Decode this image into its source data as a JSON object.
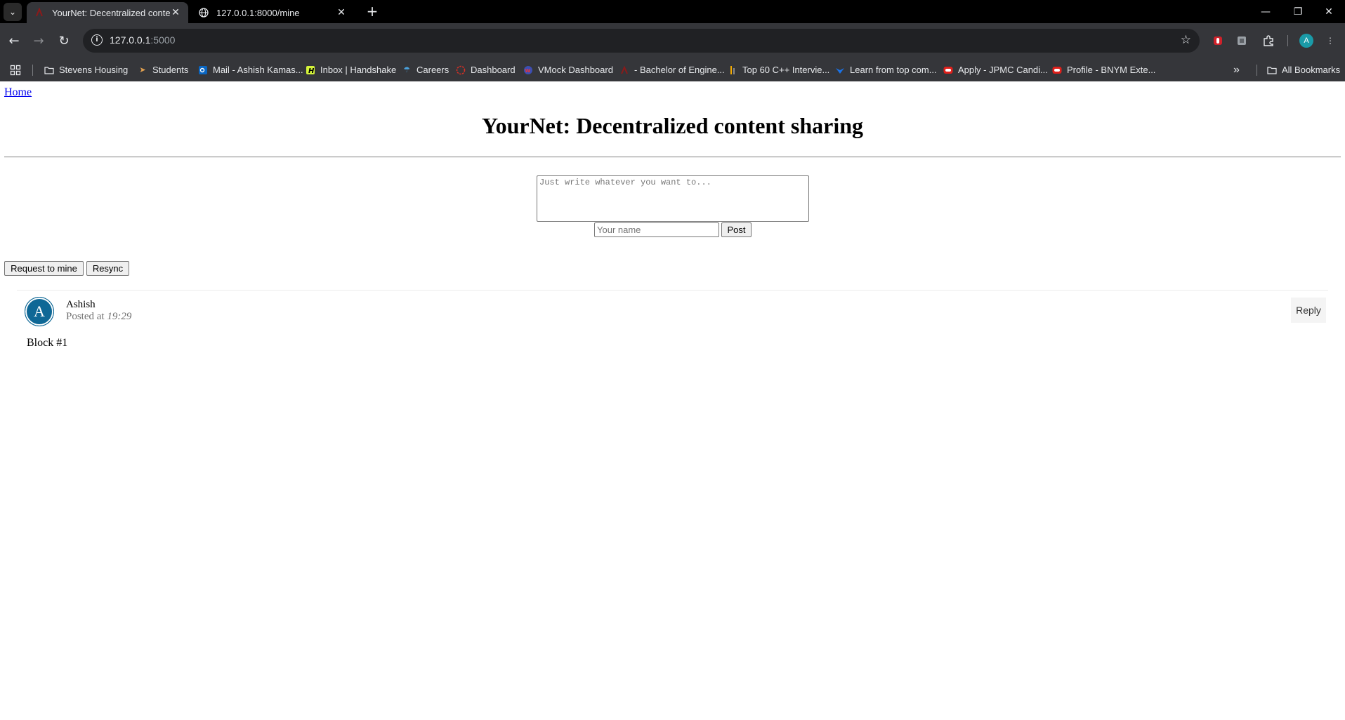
{
  "browser": {
    "tabs": [
      {
        "title": "YourNet: Decentralized content sharing",
        "active": true
      },
      {
        "title": "127.0.0.1:8000/mine",
        "active": false
      }
    ],
    "new_tab_label": "+",
    "url_host": "127.0.0.1",
    "url_rest": ":5000",
    "profile_initial": "A",
    "bookmarks": [
      "Stevens Housing",
      "Students",
      "Mail - Ashish Kamas...",
      "Inbox | Handshake",
      "Careers",
      "Dashboard",
      "VMock Dashboard",
      "- Bachelor of Engine...",
      "Top 60 C++ Intervie...",
      "Learn from top com...",
      "Apply - JPMC Candi...",
      "Profile - BNYM Exte..."
    ],
    "bookmarks_overflow": "»",
    "all_bookmarks": "All Bookmarks"
  },
  "page": {
    "home_link": "Home",
    "title": "YourNet: Decentralized content sharing",
    "content_placeholder": "Just write whatever you want to...",
    "name_placeholder": "Your name",
    "post_button": "Post",
    "request_mine_button": "Request to mine",
    "resync_button": "Resync",
    "posts": [
      {
        "avatar_initial": "A",
        "author": "Ashish",
        "posted_prefix": "Posted at",
        "time": "19:29",
        "reply_label": "Reply",
        "content": "Block #1"
      }
    ]
  },
  "colors": {
    "avatar": "#0f6896",
    "link": "#0000ee",
    "chrome_bg": "#35363a"
  }
}
